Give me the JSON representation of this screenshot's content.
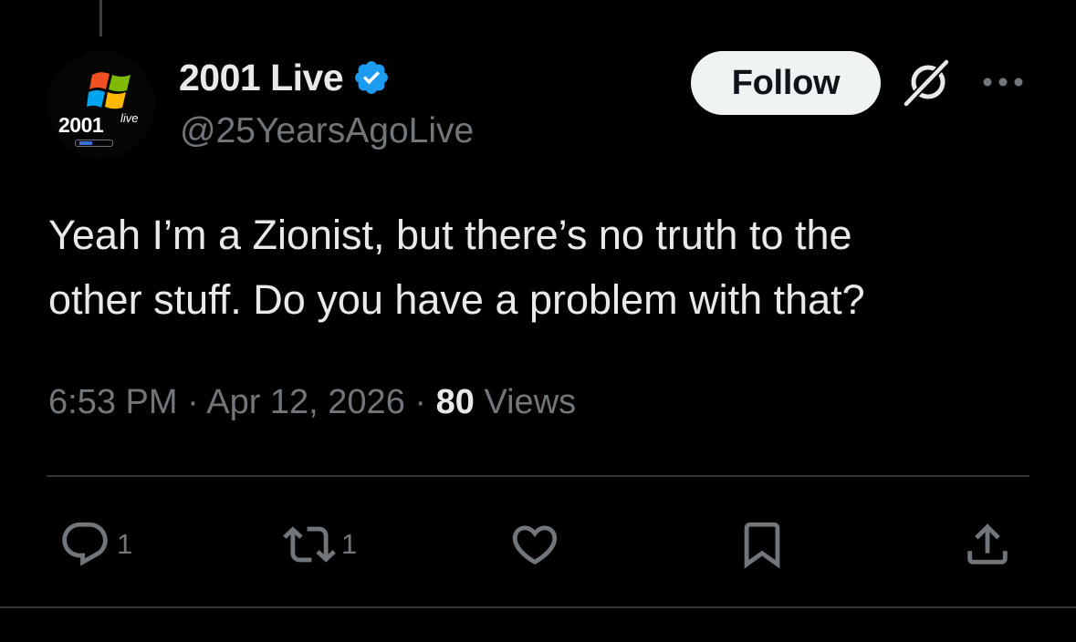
{
  "author": {
    "display_name": "2001 Live",
    "handle": "@25YearsAgoLive",
    "verified": true,
    "avatar": {
      "text": "2001",
      "superscript": "live"
    }
  },
  "follow_button": {
    "label": "Follow"
  },
  "tweet": {
    "text": "Yeah I’m a Zionist, but there’s no truth to the\nother stuff. Do you have a problem with that?",
    "time": "6:53 PM",
    "separator": "·",
    "date": "Apr 12, 2026",
    "views_count": "80",
    "views_label": "Views"
  },
  "actions": {
    "reply_count": "1",
    "repost_count": "1"
  },
  "colors": {
    "background": "#000000",
    "text_primary": "#e7e9ea",
    "text_secondary": "#71767b",
    "verified_badge": "#1d9bf0",
    "follow_bg": "#eff3f4",
    "divider": "#2f3336"
  },
  "icons": {
    "verified": "verified-badge-icon",
    "grok": "grok-icon",
    "more": "more-options-icon",
    "reply": "reply-icon",
    "repost": "repost-icon",
    "like": "heart-icon",
    "bookmark": "bookmark-icon",
    "share": "share-icon"
  }
}
